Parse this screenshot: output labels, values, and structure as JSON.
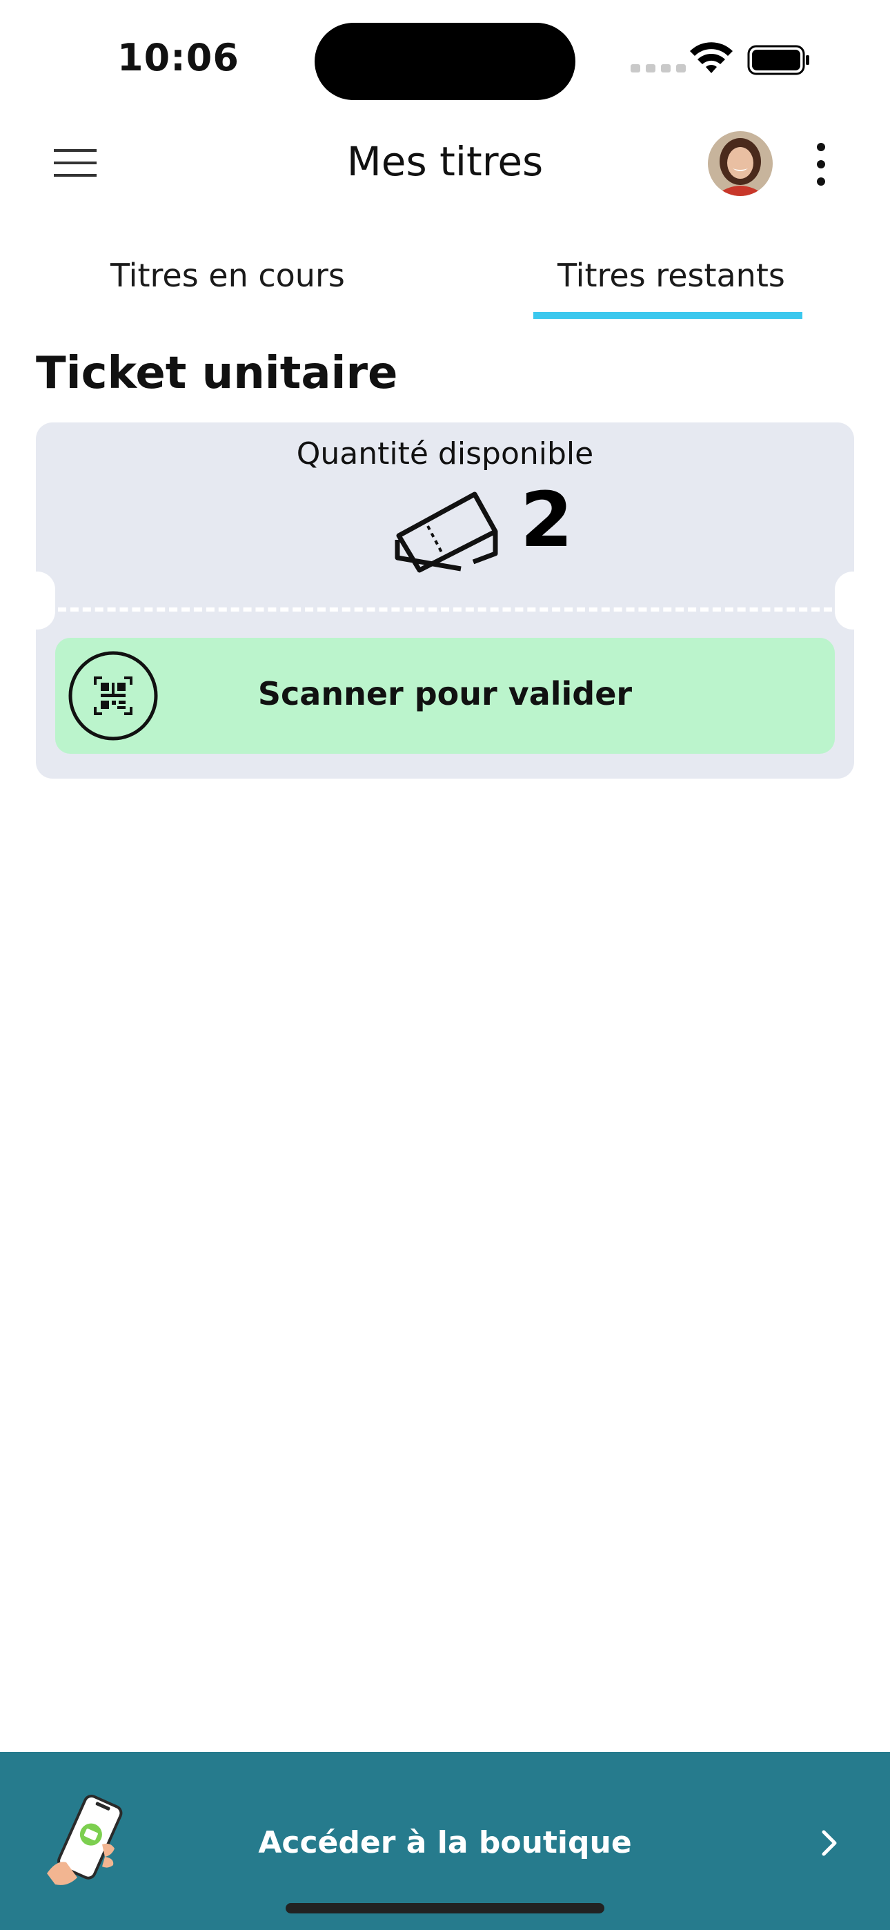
{
  "status_bar": {
    "time": "10:06"
  },
  "header": {
    "title": "Mes titres",
    "menu_icon": "hamburger-menu-icon",
    "more_icon": "vertical-dots-icon"
  },
  "tabs": [
    {
      "label": "Titres en cours",
      "selected": false
    },
    {
      "label": "Titres restants",
      "selected": true
    }
  ],
  "section": {
    "title": "Ticket unitaire"
  },
  "ticket": {
    "quantity_label": "Quantité disponible",
    "quantity": "2",
    "scan_label": "Scanner pour valider",
    "scan_icon": "qr-scan-icon",
    "ticket_icon": "tickets-icon"
  },
  "bottom_bar": {
    "label": "Accéder à la boutique",
    "icon": "phone-shop-icon"
  },
  "colors": {
    "accent": "#3bc8ee",
    "card_background": "#e6e9f1",
    "scan_button": "#bbf4cc",
    "bottom_bar": "#267b8d"
  }
}
